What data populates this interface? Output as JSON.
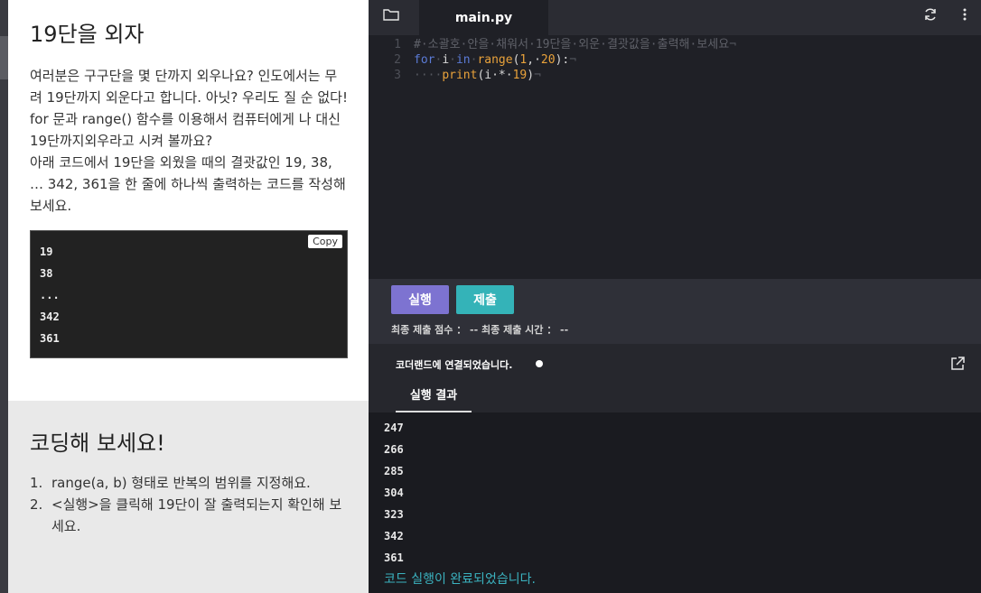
{
  "lesson": {
    "title": "19단을 외자",
    "description": [
      "여러분은 구구단을 몇 단까지 외우나요? 인도에서는 무려 19단까지 외운다고 합니다. 아닛? 우리도 질 순 없다! for 문과 range() 함수를 이용해서 컴퓨터에게 나 대신 19단까지외우라고 시켜 볼까요?",
      "아래 코드에서 19단을 외웠을 때의 결괏값인 19, 38, … 342, 361을 한 줄에 하나씩 출력하는 코드를 작성해 보세요."
    ],
    "copy_label": "Copy",
    "expected_output": [
      "19",
      "38",
      "...",
      "342",
      "361"
    ]
  },
  "practice": {
    "title": "코딩해 보세요!",
    "items": [
      {
        "num": "1.",
        "text": "range(a, b) 형태로 반복의 범위를 지정해요."
      },
      {
        "num": "2.",
        "text": "<실행>을 클릭해 19단이 잘 출력되는지 확인해 보세요."
      }
    ]
  },
  "editor": {
    "filename": "main.py",
    "line_numbers": [
      "1",
      "2",
      "3"
    ],
    "code": {
      "line1_comment": "#·소괄호·안을·채워서·19단을·외운·결괏값을·출력해·보세요",
      "line2_for": "for",
      "line2_i": "i",
      "line2_in": "in",
      "line2_range": "range",
      "line2_open": "(",
      "line2_a": "1",
      "line2_comma": ",·",
      "line2_b": "20",
      "line2_close": "):",
      "line3_indent": "····",
      "line3_print": "print",
      "line3_expr": "(i·*·",
      "line3_num": "19",
      "line3_close": ")",
      "eol": "¬"
    }
  },
  "controls": {
    "run_label": "실행",
    "submit_label": "제출",
    "score_text": "최종 제출 점수 ： --  최종 제출 시간 ： --"
  },
  "result": {
    "connection_text": "코더랜드에 연결되었습니다.",
    "tab_label": "실행 결과",
    "output_lines": [
      "247",
      "266",
      "285",
      "304",
      "323",
      "342",
      "361"
    ],
    "done_text": "코드 실행이 완료되었습니다."
  }
}
